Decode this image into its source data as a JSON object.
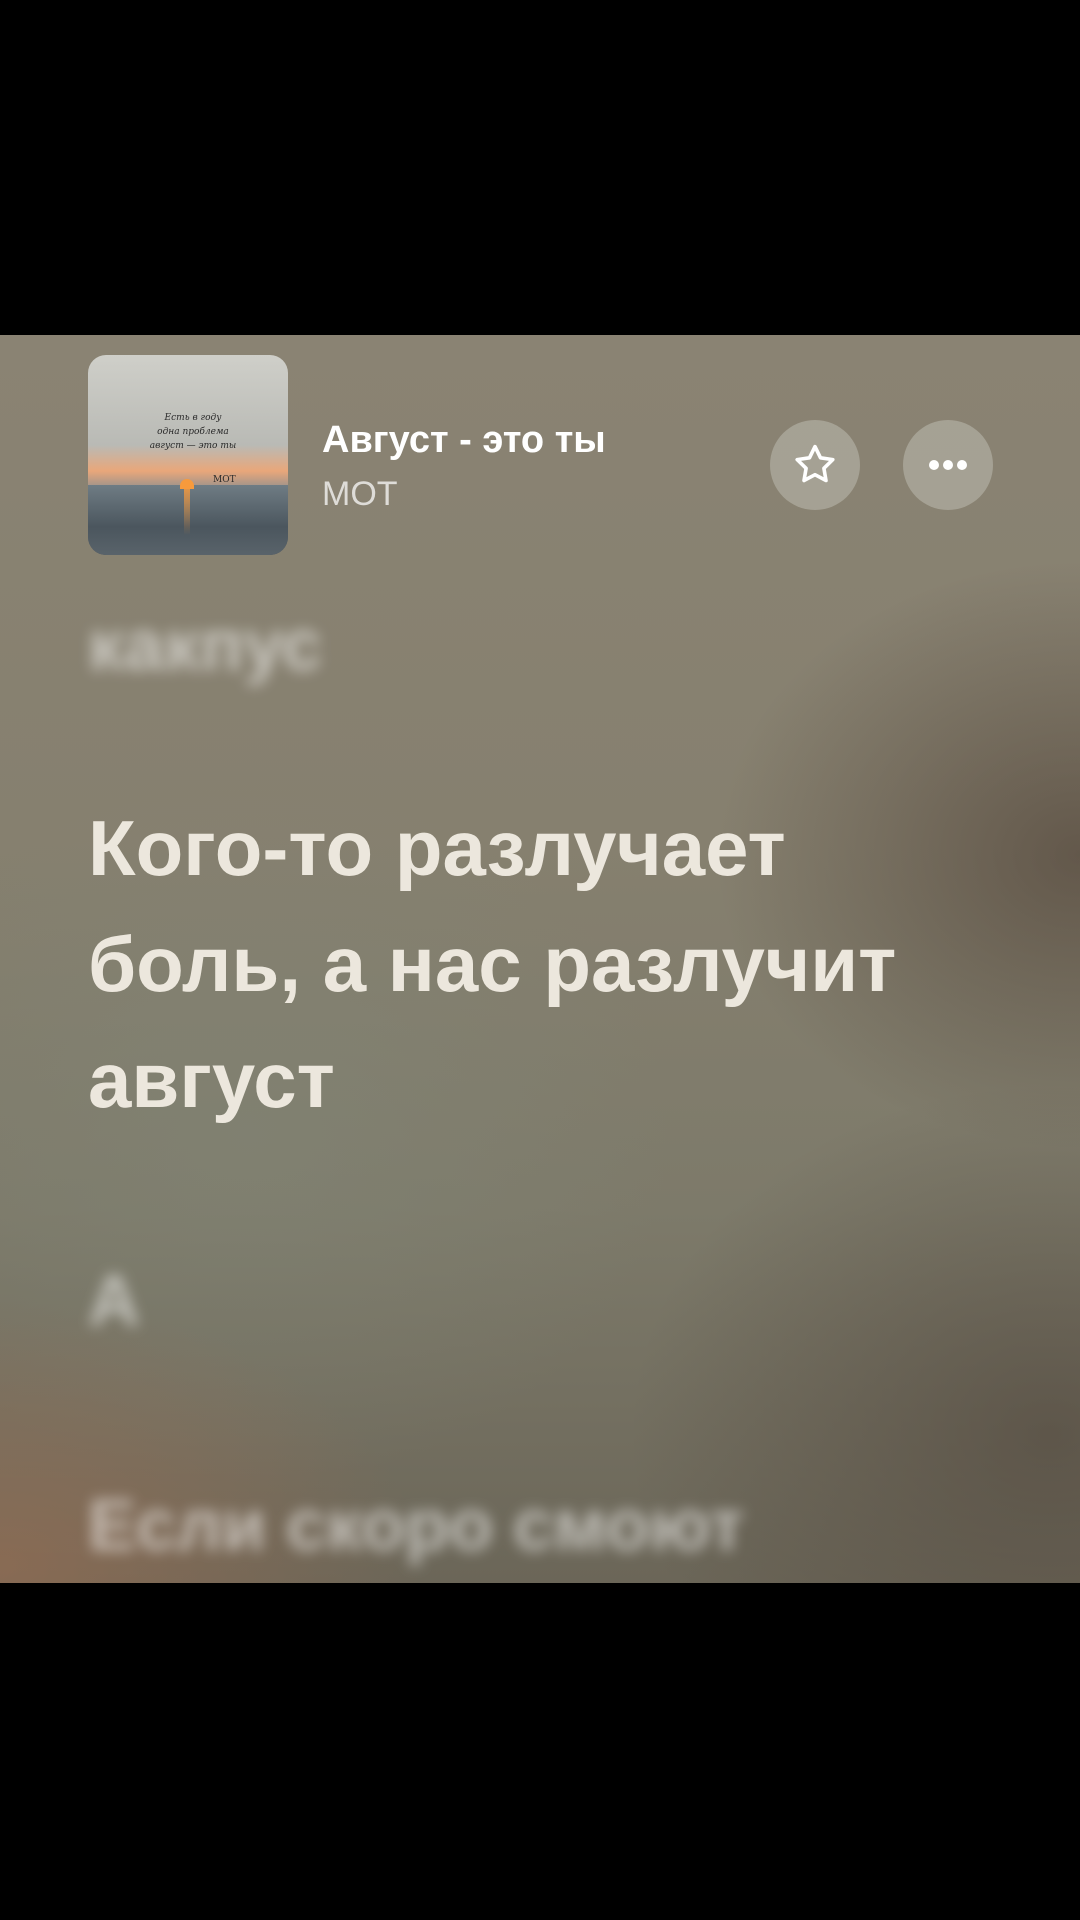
{
  "now_playing": {
    "title": "Август - это ты",
    "artist": "МОТ",
    "cover": {
      "note_lines": [
        "Есть в году",
        "одна проблема",
        "август — это ты"
      ],
      "signature": "МОТ"
    }
  },
  "actions": {
    "favorite_icon": "star-icon",
    "more_icon": "more-horizontal-icon"
  },
  "lyrics": {
    "previous_line": "какпус",
    "current_line": "Кого-то разлучает боль, а нас разлучит август",
    "next_lines": [
      "А",
      "Если скоро смоют"
    ]
  },
  "colors": {
    "background_top": "#8a8373",
    "current_lyric": "#ece7dd",
    "button_fill": "#cdcdc3"
  }
}
